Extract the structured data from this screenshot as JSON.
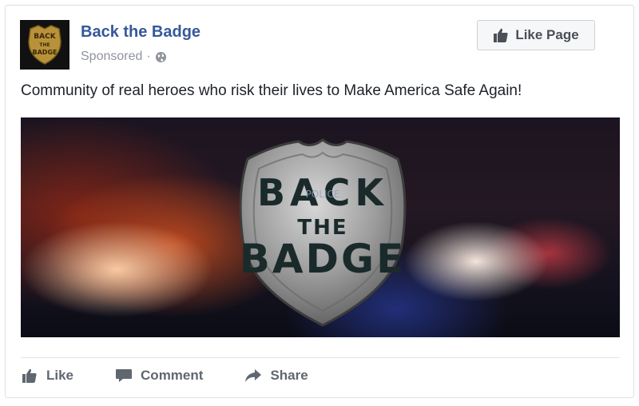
{
  "post": {
    "page_name": "Back the Badge",
    "sponsored_label": "Sponsored",
    "separator": "·",
    "text": "Community of real heroes who risk their lives to Make America Safe Again!"
  },
  "header": {
    "like_page_label": "Like Page"
  },
  "avatar": {
    "badge_line1": "BACK",
    "badge_line2": "THE",
    "badge_line3": "BADGE"
  },
  "hero": {
    "line1": "BACK",
    "line2": "THE",
    "line3": "BADGE",
    "small": "POLICE"
  },
  "actions": {
    "like_label": "Like",
    "comment_label": "Comment",
    "share_label": "Share"
  },
  "icons": {
    "globe": "globe-icon",
    "thumb": "thumbs-up-icon",
    "comment": "comment-icon",
    "share": "share-icon"
  },
  "colors": {
    "link": "#365899",
    "muted": "#90949c",
    "action_text": "#606770"
  }
}
